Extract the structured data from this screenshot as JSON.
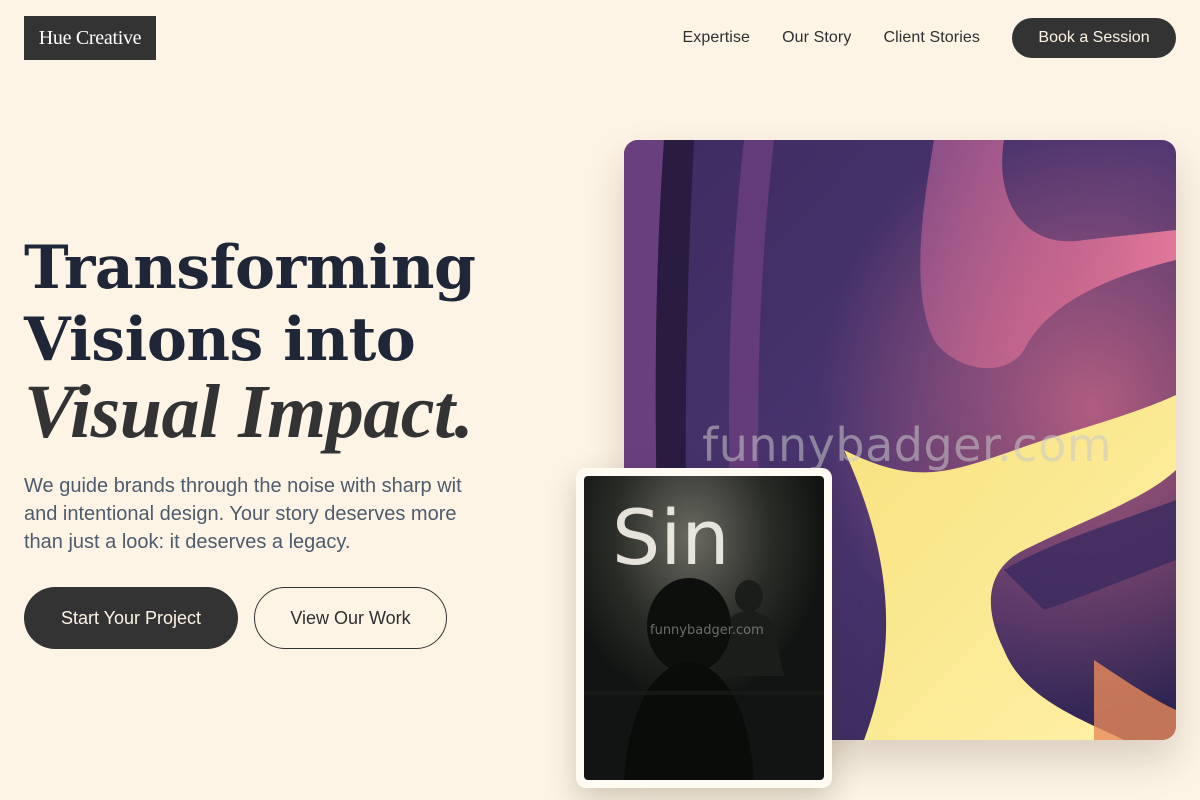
{
  "brand": {
    "name": "Hue Creative"
  },
  "nav": {
    "links": [
      "Expertise",
      "Our Story",
      "Client Stories"
    ],
    "cta": "Book a Session"
  },
  "hero": {
    "headline_line1": "Transforming",
    "headline_line2": "Visions into",
    "headline_emphasis": "Visual Impact.",
    "subtext": "We guide brands through the noise with sharp wit and intentional design. Your story deserves more than just a look: it deserves a legacy.",
    "primary_cta": "Start Your Project",
    "secondary_cta": "View Our Work"
  },
  "images": {
    "main_watermark": "funnybadger.com",
    "card_watermark": "funnybadger.com",
    "card_neon_text": "Sin"
  },
  "colors": {
    "background": "#fdf4e6",
    "dark": "#333333",
    "headline": "#1e2638",
    "body_text": "#4e5b6c"
  }
}
